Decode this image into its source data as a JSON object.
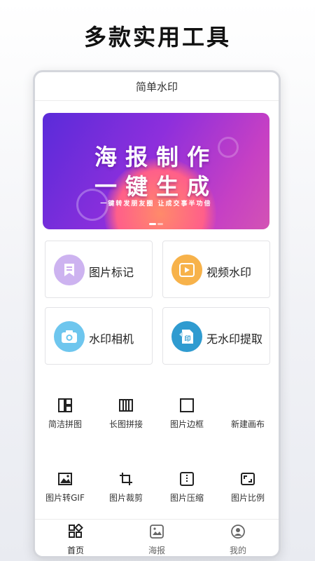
{
  "headline": "多款实用工具",
  "app": {
    "title": "简单水印"
  },
  "banner": {
    "line1": "海报制作",
    "line2": "一键生成",
    "tagline": "一键转发朋友圈 让成交事半功倍",
    "slide_count": 2,
    "active_slide": 1
  },
  "features": [
    {
      "label": "图片标记",
      "icon": "bookmark-icon",
      "color": "#cdb3f0"
    },
    {
      "label": "视频水印",
      "icon": "play-icon",
      "color": "#f7b24a"
    },
    {
      "label": "水印相机",
      "icon": "camera-icon",
      "color": "#6ec6ee"
    },
    {
      "label": "无水印提取",
      "icon": "watermark-extract-icon",
      "color": "#2f9bd0"
    }
  ],
  "tools": [
    {
      "label": "简洁拼图",
      "icon": "simple-collage-icon"
    },
    {
      "label": "长图拼接",
      "icon": "long-image-stitch-icon"
    },
    {
      "label": "图片边框",
      "icon": "image-border-icon"
    },
    {
      "label": "新建画布",
      "icon": "new-canvas-icon"
    },
    {
      "label": "图片转GIF",
      "icon": "image-to-gif-icon"
    },
    {
      "label": "图片裁剪",
      "icon": "crop-icon"
    },
    {
      "label": "图片压缩",
      "icon": "compress-icon"
    },
    {
      "label": "图片比例",
      "icon": "aspect-ratio-icon"
    }
  ],
  "nav": [
    {
      "label": "首页",
      "icon": "home-grid-icon",
      "active": true
    },
    {
      "label": "海报",
      "icon": "poster-icon",
      "active": false
    },
    {
      "label": "我的",
      "icon": "profile-icon",
      "active": false
    }
  ]
}
